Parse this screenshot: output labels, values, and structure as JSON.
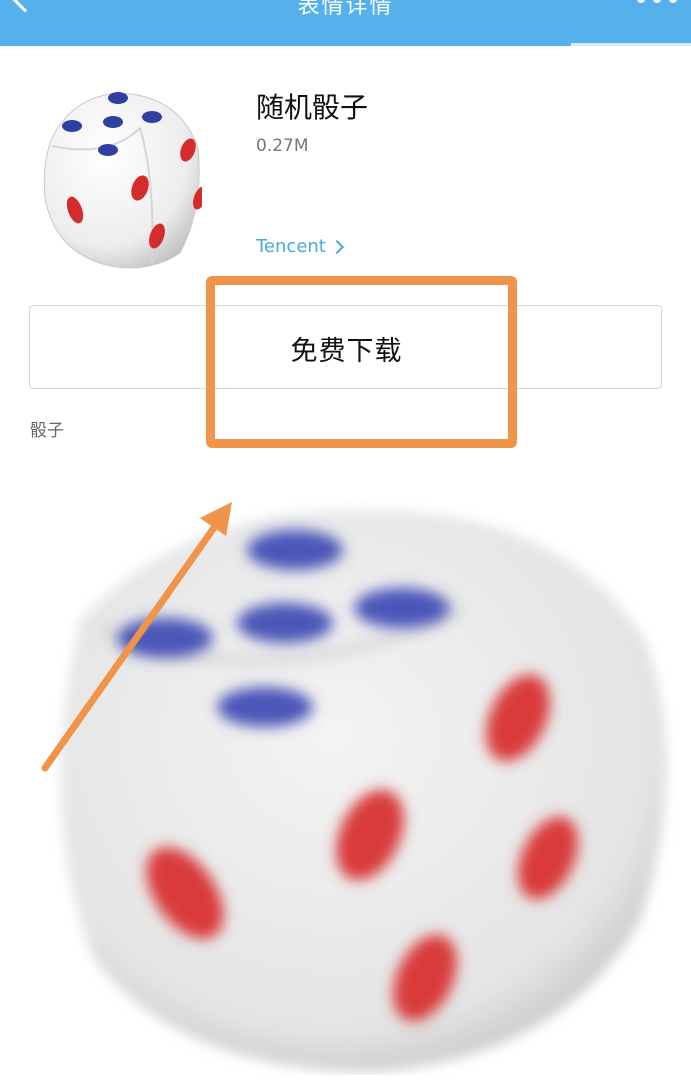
{
  "header": {
    "title": "表情详情",
    "back_icon": "chevron-left-icon",
    "more_icon": "more-dots-icon",
    "background": "#56b0ec"
  },
  "sticker": {
    "name": "随机骰子",
    "size": "0.27M",
    "author": "Tencent",
    "download_label": "免费下载",
    "tag": "骰子",
    "thumbnail_icon": "dice-icon",
    "preview_icon": "rolling-dice-icon"
  },
  "annotation": {
    "highlight_color": "#ef9448",
    "arrow_icon": "annotation-arrow-icon"
  }
}
